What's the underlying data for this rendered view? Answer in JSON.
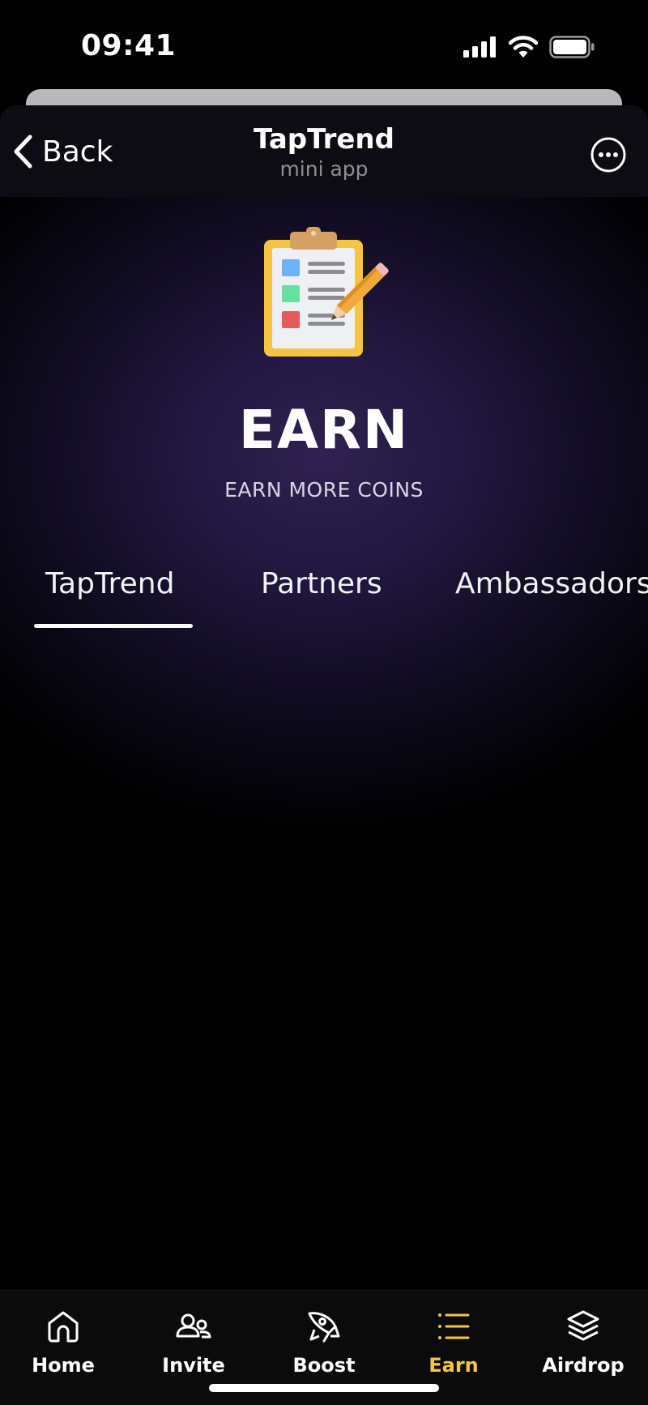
{
  "status_bar": {
    "time": "09:41"
  },
  "header": {
    "back_label": "Back",
    "title": "TapTrend",
    "subtitle": "mini app",
    "more_icon": "ellipsis-circle-icon"
  },
  "hero": {
    "icon": "clipboard-checklist-icon",
    "title": "EARN",
    "subtitle": "EARN MORE COINS"
  },
  "tabs": [
    {
      "label": "TapTrend",
      "active": true
    },
    {
      "label": "Partners",
      "active": false
    },
    {
      "label": "Ambassadors",
      "active": false
    }
  ],
  "bottom_nav": {
    "items": [
      {
        "label": "Home",
        "icon": "home-icon",
        "active": false
      },
      {
        "label": "Invite",
        "icon": "users-icon",
        "active": false
      },
      {
        "label": "Boost",
        "icon": "rocket-icon",
        "active": false
      },
      {
        "label": "Earn",
        "icon": "list-icon",
        "active": true
      },
      {
        "label": "Airdrop",
        "icon": "layers-icon",
        "active": false
      }
    ]
  },
  "colors": {
    "accent": "#f5c443",
    "background": "#000000",
    "glow": "#2f2150"
  }
}
